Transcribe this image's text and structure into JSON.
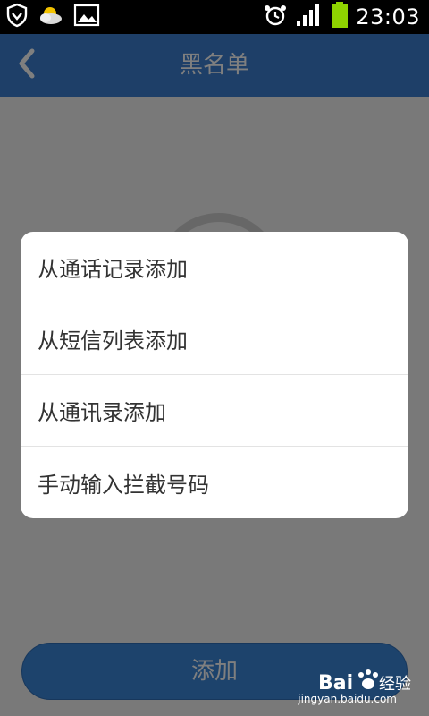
{
  "status_bar": {
    "time": "23:03",
    "icons": [
      "shield-icon",
      "weather-icon",
      "image-icon",
      "alarm-icon",
      "signal-icon",
      "battery-icon"
    ]
  },
  "header": {
    "title": "黑名单",
    "back_icon": "chevron-left-icon"
  },
  "menu": {
    "items": [
      {
        "label": "从通话记录添加"
      },
      {
        "label": "从短信列表添加"
      },
      {
        "label": "从通讯录添加"
      },
      {
        "label": "手动输入拦截号码"
      }
    ]
  },
  "main": {
    "add_button_label": "添加"
  },
  "watermark": {
    "brand": "Bai 经验",
    "domain": "jingyan.baidu.com"
  },
  "colors": {
    "title_bar": "#3c7fd0",
    "add_button": "#3a86d8",
    "battery": "#8fd400"
  }
}
